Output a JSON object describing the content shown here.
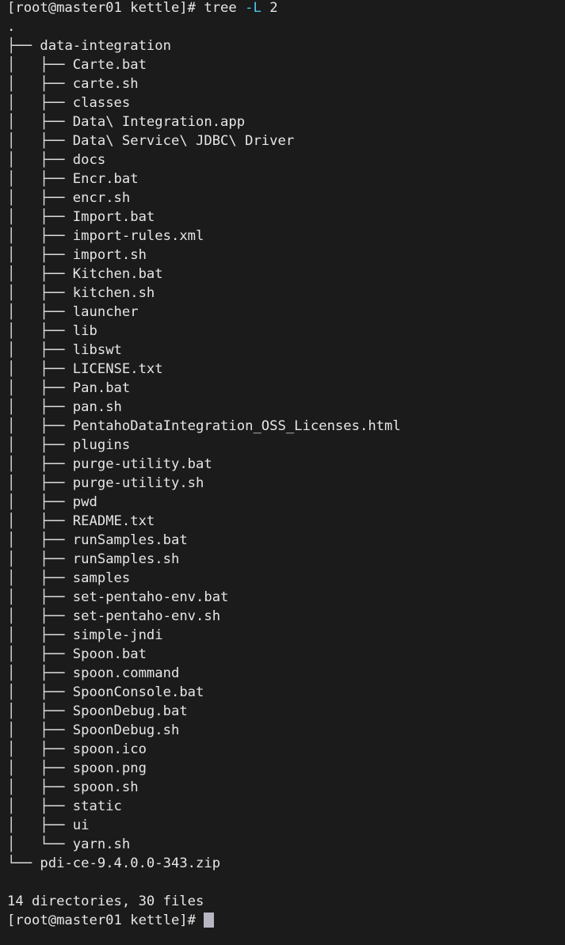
{
  "terminal": {
    "background_color": "#1b1b1b",
    "foreground_color": "#e6e6e6",
    "flag_color": "#4fc3e8",
    "cursor_color": "#b7b7c2",
    "font_size_px": 17,
    "line_height_px": 24,
    "columns": 58,
    "rows": 50
  },
  "prompt": {
    "text": "[root@master01 kettle]# ",
    "user": "root",
    "host": "master01",
    "cwd": "kettle",
    "symbol": "#"
  },
  "command": {
    "name": "tree",
    "flag": "-L",
    "argument": "2",
    "full": "tree -L 2"
  },
  "tree": {
    "root": ".",
    "branch_mid": "├── ",
    "branch_last": "└── ",
    "pipe": "│   ",
    "indent": "    ",
    "entries": [
      {
        "name": "data-integration",
        "depth": 1,
        "last": false
      },
      {
        "name": "Carte.bat",
        "depth": 2,
        "last": false
      },
      {
        "name": "carte.sh",
        "depth": 2,
        "last": false
      },
      {
        "name": "classes",
        "depth": 2,
        "last": false
      },
      {
        "name": "Data\\ Integration.app",
        "depth": 2,
        "last": false
      },
      {
        "name": "Data\\ Service\\ JDBC\\ Driver",
        "depth": 2,
        "last": false
      },
      {
        "name": "docs",
        "depth": 2,
        "last": false
      },
      {
        "name": "Encr.bat",
        "depth": 2,
        "last": false
      },
      {
        "name": "encr.sh",
        "depth": 2,
        "last": false
      },
      {
        "name": "Import.bat",
        "depth": 2,
        "last": false
      },
      {
        "name": "import-rules.xml",
        "depth": 2,
        "last": false
      },
      {
        "name": "import.sh",
        "depth": 2,
        "last": false
      },
      {
        "name": "Kitchen.bat",
        "depth": 2,
        "last": false
      },
      {
        "name": "kitchen.sh",
        "depth": 2,
        "last": false
      },
      {
        "name": "launcher",
        "depth": 2,
        "last": false
      },
      {
        "name": "lib",
        "depth": 2,
        "last": false
      },
      {
        "name": "libswt",
        "depth": 2,
        "last": false
      },
      {
        "name": "LICENSE.txt",
        "depth": 2,
        "last": false
      },
      {
        "name": "Pan.bat",
        "depth": 2,
        "last": false
      },
      {
        "name": "pan.sh",
        "depth": 2,
        "last": false
      },
      {
        "name": "PentahoDataIntegration_OSS_Licenses.html",
        "depth": 2,
        "last": false
      },
      {
        "name": "plugins",
        "depth": 2,
        "last": false
      },
      {
        "name": "purge-utility.bat",
        "depth": 2,
        "last": false
      },
      {
        "name": "purge-utility.sh",
        "depth": 2,
        "last": false
      },
      {
        "name": "pwd",
        "depth": 2,
        "last": false
      },
      {
        "name": "README.txt",
        "depth": 2,
        "last": false
      },
      {
        "name": "runSamples.bat",
        "depth": 2,
        "last": false
      },
      {
        "name": "runSamples.sh",
        "depth": 2,
        "last": false
      },
      {
        "name": "samples",
        "depth": 2,
        "last": false
      },
      {
        "name": "set-pentaho-env.bat",
        "depth": 2,
        "last": false
      },
      {
        "name": "set-pentaho-env.sh",
        "depth": 2,
        "last": false
      },
      {
        "name": "simple-jndi",
        "depth": 2,
        "last": false
      },
      {
        "name": "Spoon.bat",
        "depth": 2,
        "last": false
      },
      {
        "name": "spoon.command",
        "depth": 2,
        "last": false
      },
      {
        "name": "SpoonConsole.bat",
        "depth": 2,
        "last": false
      },
      {
        "name": "SpoonDebug.bat",
        "depth": 2,
        "last": false
      },
      {
        "name": "SpoonDebug.sh",
        "depth": 2,
        "last": false
      },
      {
        "name": "spoon.ico",
        "depth": 2,
        "last": false
      },
      {
        "name": "spoon.png",
        "depth": 2,
        "last": false
      },
      {
        "name": "spoon.sh",
        "depth": 2,
        "last": false
      },
      {
        "name": "static",
        "depth": 2,
        "last": false
      },
      {
        "name": "ui",
        "depth": 2,
        "last": false
      },
      {
        "name": "yarn.sh",
        "depth": 2,
        "last": true
      },
      {
        "name": "pdi-ce-9.4.0.0-343.zip",
        "depth": 1,
        "last": true
      }
    ]
  },
  "summary": {
    "directories": 14,
    "files": 30,
    "text": "14 directories, 30 files"
  }
}
